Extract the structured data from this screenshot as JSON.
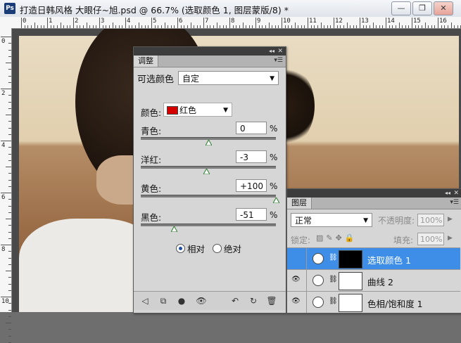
{
  "window": {
    "app_icon": "Ps",
    "title": "打造日韩风格 大眼仔~旭.psd @ 66.7% (选取颜色 1, 图层蒙版/8) *",
    "buttons": {
      "minimize": "—",
      "restore": "❐",
      "close": "✕"
    }
  },
  "rulers": {
    "h_labels": [
      "0",
      "1",
      "2",
      "3",
      "4",
      "5",
      "6",
      "7",
      "8",
      "9",
      "10",
      "11",
      "12",
      "13",
      "14",
      "15",
      "16",
      "17"
    ],
    "v_labels": [
      "0",
      "2",
      "4",
      "6",
      "8",
      "10"
    ]
  },
  "adjustments": {
    "tab": "调整",
    "section_title": "可选颜色",
    "preset_value": "自定",
    "colors_label": "颜色:",
    "colors_value": "红色",
    "colors_swatch": "#d40000",
    "sliders": [
      {
        "label": "青色:",
        "value": "0",
        "unit": "%",
        "fraction": 0.5
      },
      {
        "label": "洋红:",
        "value": "-3",
        "unit": "%",
        "fraction": 0.485
      },
      {
        "label": "黄色:",
        "value": "+100",
        "unit": "%",
        "fraction": 1.0
      },
      {
        "label": "黑色:",
        "value": "-51",
        "unit": "%",
        "fraction": 0.245
      }
    ],
    "method": {
      "relative": "相对",
      "absolute": "绝对",
      "selected": "relative"
    }
  },
  "layers": {
    "tab": "图层",
    "blend_mode": "正常",
    "opacity_label": "不透明度:",
    "opacity_value": "100%",
    "lock_label": "锁定:",
    "fill_label": "填充:",
    "fill_value": "100%",
    "items": [
      {
        "name": "选取颜色 1",
        "selected": true,
        "mask": "dark",
        "visible": false
      },
      {
        "name": "曲线 2",
        "selected": false,
        "mask": "white",
        "visible": true
      },
      {
        "name": "色相/饱和度 1",
        "selected": false,
        "mask": "white",
        "visible": true
      }
    ]
  },
  "colors": {
    "selection": "#3e8ee8",
    "panel": "#d6d6d6",
    "panel_dark": "#3d3d3d"
  }
}
